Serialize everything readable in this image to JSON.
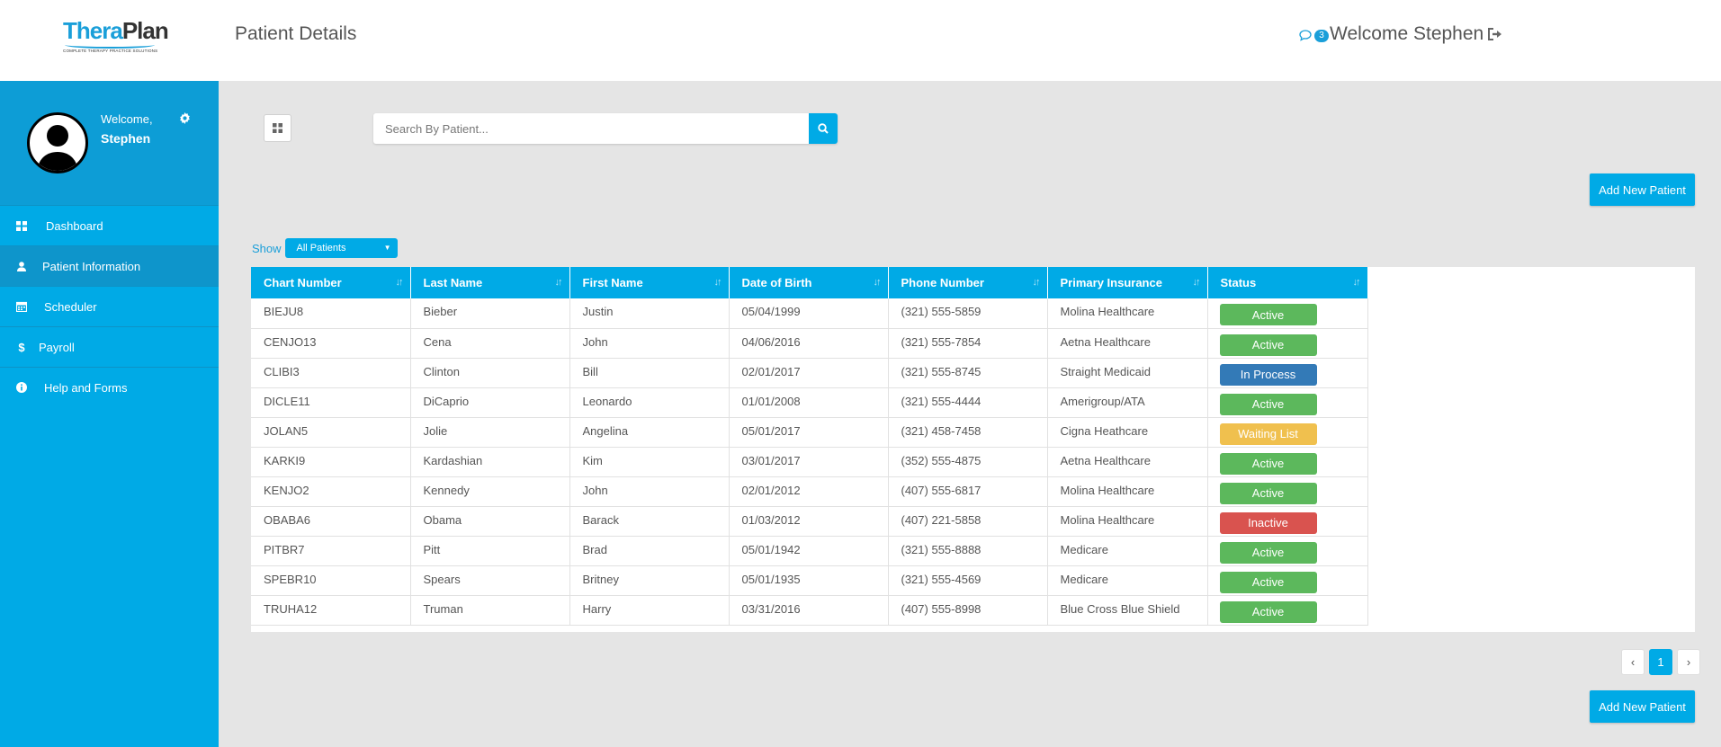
{
  "app": {
    "logo_part1": "Thera",
    "logo_part2": "Plan",
    "logo_tagline": "COMPLETE THERAPY PRACTICE SOLUTIONS",
    "page_title": "Patient Details",
    "messages_count": "3",
    "welcome": "Welcome Stephen"
  },
  "sidebar": {
    "welcome": "Welcome,",
    "user_name": "Stephen",
    "items": [
      {
        "label": "Dashboard",
        "icon": "dashboard-icon"
      },
      {
        "label": "Patient Information",
        "icon": "user-icon",
        "active": true
      },
      {
        "label": "Scheduler",
        "icon": "calendar-icon"
      },
      {
        "label": "Payroll",
        "icon": "dollar-icon"
      },
      {
        "label": "Help and Forms",
        "icon": "info-icon"
      }
    ]
  },
  "search": {
    "placeholder": "Search By Patient..."
  },
  "actions": {
    "add_new_patient": "Add New Patient"
  },
  "filter": {
    "show_label": "Show",
    "selected": "All Patients"
  },
  "table": {
    "columns": [
      "Chart Number",
      "Last Name",
      "First Name",
      "Date of Birth",
      "Phone Number",
      "Primary Insurance",
      "Status"
    ],
    "rows": [
      {
        "chart": "BIEJU8",
        "last": "Bieber",
        "first": "Justin",
        "dob": "05/04/1999",
        "phone": "(321) 555-5859",
        "insurance": "Molina Healthcare",
        "status": "Active"
      },
      {
        "chart": "CENJO13",
        "last": "Cena",
        "first": "John",
        "dob": "04/06/2016",
        "phone": "(321) 555-7854",
        "insurance": "Aetna Healthcare",
        "status": "Active"
      },
      {
        "chart": "CLIBI3",
        "last": "Clinton",
        "first": "Bill",
        "dob": "02/01/2017",
        "phone": "(321) 555-8745",
        "insurance": "Straight Medicaid",
        "status": "In Process"
      },
      {
        "chart": "DICLE11",
        "last": "DiCaprio",
        "first": "Leonardo",
        "dob": "01/01/2008",
        "phone": "(321) 555-4444",
        "insurance": "Amerigroup/ATA",
        "status": "Active"
      },
      {
        "chart": "JOLAN5",
        "last": "Jolie",
        "first": "Angelina",
        "dob": "05/01/2017",
        "phone": "(321) 458-7458",
        "insurance": "Cigna Heathcare",
        "status": "Waiting List"
      },
      {
        "chart": "KARKI9",
        "last": "Kardashian",
        "first": "Kim",
        "dob": "03/01/2017",
        "phone": "(352) 555-4875",
        "insurance": "Aetna Healthcare",
        "status": "Active"
      },
      {
        "chart": "KENJO2",
        "last": "Kennedy",
        "first": "John",
        "dob": "02/01/2012",
        "phone": "(407) 555-6817",
        "insurance": "Molina Healthcare",
        "status": "Active"
      },
      {
        "chart": "OBABA6",
        "last": "Obama",
        "first": "Barack",
        "dob": "01/03/2012",
        "phone": "(407) 221-5858",
        "insurance": "Molina Healthcare",
        "status": "Inactive"
      },
      {
        "chart": "PITBR7",
        "last": "Pitt",
        "first": "Brad",
        "dob": "05/01/1942",
        "phone": "(321) 555-8888",
        "insurance": "Medicare",
        "status": "Active"
      },
      {
        "chart": "SPEBR10",
        "last": "Spears",
        "first": "Britney",
        "dob": "05/01/1935",
        "phone": "(321) 555-4569",
        "insurance": "Medicare",
        "status": "Active"
      },
      {
        "chart": "TRUHA12",
        "last": "Truman",
        "first": "Harry",
        "dob": "03/31/2016",
        "phone": "(407) 555-8998",
        "insurance": "Blue Cross Blue Shield",
        "status": "Active"
      }
    ]
  },
  "status_colors": {
    "Active": "#5cb85c",
    "In Process": "#337ab7",
    "Waiting List": "#f0c04e",
    "Inactive": "#d9534f"
  },
  "pagination": {
    "current_page": "1"
  },
  "colors": {
    "accent": "#00aae6",
    "sidebar_profile": "#0d9dd6",
    "background": "#e5e5e5"
  }
}
